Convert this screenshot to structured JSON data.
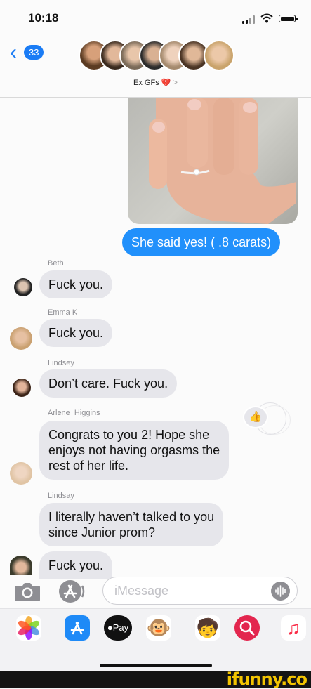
{
  "status": {
    "time": "10:18"
  },
  "header": {
    "unread_count": "33",
    "group_name": "Ex GFs",
    "heart": "💔",
    "chevron": ">"
  },
  "outgoing": {
    "text": "She said yes! ( .8 carats)"
  },
  "messages": [
    {
      "sender": "Beth",
      "text": "Fuck you."
    },
    {
      "sender": "Emma K",
      "text": "Fuck you."
    },
    {
      "sender": "Lindsey",
      "text": "Don’t care. Fuck you."
    },
    {
      "sender": "Arlene  Higgins",
      "text": "Congrats to you 2! Hope she\nenjoys not having orgasms the\nrest of her life."
    },
    {
      "sender": "Lindsay",
      "text": "I literally haven’t talked to you\nsince Junior prom?"
    },
    {
      "sender": "",
      "text": "Fuck you."
    }
  ],
  "tapback": {
    "icon": "thumbs-up-icon",
    "glyph": "👍"
  },
  "input": {
    "placeholder": "iMessage",
    "value": ""
  },
  "app_drawer": {
    "pay_label": "Pay"
  },
  "watermark": {
    "text": "ifunny.co"
  },
  "colors": {
    "accent": "#1a7cf5",
    "bubble_blue": "#2190fb",
    "bubble_gray": "#e6e6eb",
    "badge_red": "#d62b45"
  }
}
